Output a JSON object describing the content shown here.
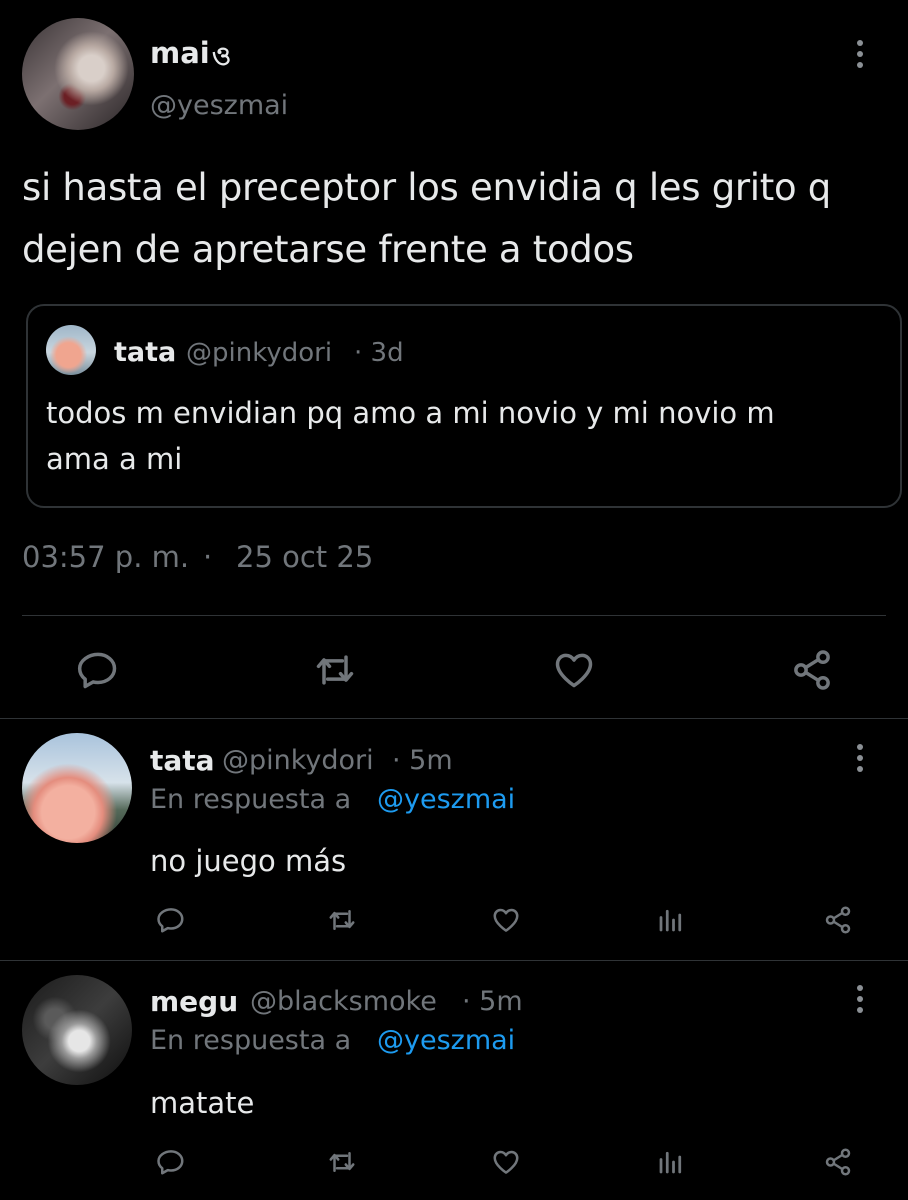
{
  "main_tweet": {
    "author_name": "mai",
    "author_badge": "ও",
    "author_handle": "@yeszmai",
    "text_line1": "si hasta el preceptor los envidia q les grito q",
    "text_line2": "dejen de apretarse frente a todos",
    "quoted": {
      "author_name": "tata",
      "author_handle": "@pinkydori",
      "time": "· 3d",
      "text_line1": "todos m envidian pq amo a mi novio y mi novio m",
      "text_line2": "ama a mi"
    },
    "time": "03:57 p. m.",
    "dot": "·",
    "date": "25 oct 25"
  },
  "replies": [
    {
      "author_name": "tata",
      "author_handle": "@pinkydori",
      "time": "· 5m",
      "reply_prefix": "En respuesta a",
      "reply_to": "@yeszmai",
      "text": "no juego más"
    },
    {
      "author_name": "megu",
      "author_handle": "@blacksmoke",
      "time": "· 5m",
      "reply_prefix": "En respuesta a",
      "reply_to": "@yeszmai",
      "text": "matate"
    }
  ],
  "colors": {
    "background": "#000000",
    "text": "#e7e9ea",
    "muted": "#71767b",
    "link": "#1d9bf0",
    "border": "#2f3336"
  }
}
